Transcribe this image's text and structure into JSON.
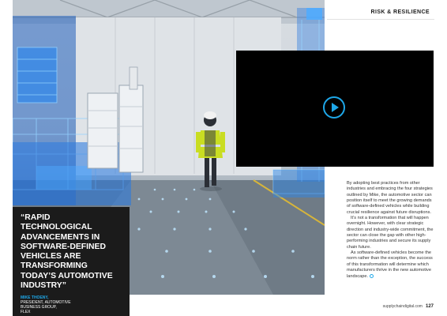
{
  "section": {
    "label": "RISK & RESILIENCE"
  },
  "quote": {
    "text": "“Rapid technological advancements in software-defined vehicles are transforming today’s automotive industry”",
    "name": "MIKE THOENY,",
    "role_line1": "PRESIDENT, AUTOMOTIVE",
    "role_line2": "BUSINESS GROUP,",
    "company": "FLEX"
  },
  "video": {
    "play_icon": "play-icon"
  },
  "body": {
    "p1": "By adopting best practices from other industries and embracing the four strategies outlined by Mike, the automotive sector can position itself to meet the growing demands of software-defined vehicles while building crucial resilience against future disruptions.",
    "p2": "It’s not a transformation that will happen overnight. However, with clear strategic direction and industry-wide commitment, the sector can close the gap with other high-performing industries and secure its supply chain future.",
    "p3": "As software-defined vehicles become the norm rather than the exception, the success of this transformation will determine which manufacturers thrive in the new automotive landscape."
  },
  "footer": {
    "site": "supplychaindigital.com",
    "page": "127"
  },
  "colors": {
    "accent": "#1ea7e8",
    "quote_bg": "#1b1b1b"
  }
}
